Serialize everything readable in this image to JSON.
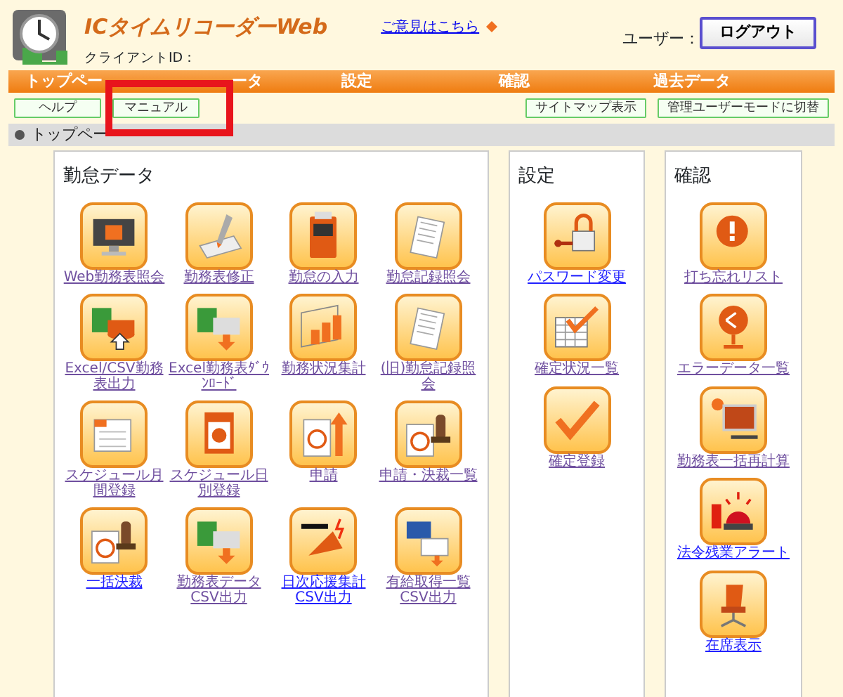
{
  "header": {
    "title": "ICタイムリコーダーWeb",
    "client_id_label": "クライアントID：",
    "feedback_link": "ご意見はこちら",
    "user_label": "ユーザー：",
    "logout_button": "ログアウト"
  },
  "nav_tabs": [
    "トップペー",
    "ータ",
    "設定",
    "確認",
    "過去データ"
  ],
  "sub_buttons_left": [
    "ヘルプ",
    "マニュアル"
  ],
  "sub_buttons_right": [
    "サイトマップ表示",
    "管理ユーザーモードに切替"
  ],
  "breadcrumb": "トップペー",
  "panels": [
    {
      "title": "勤怠データ",
      "items": [
        {
          "label": "Web勤務表照会",
          "visited": true
        },
        {
          "label": "勤務表修正",
          "visited": true
        },
        {
          "label": "勤怠の入力",
          "visited": true
        },
        {
          "label": "勤怠記録照会",
          "visited": true
        },
        {
          "label": "Excel/CSV勤務表出力",
          "visited": true
        },
        {
          "label": "Excel勤務表ﾀﾞｳﾝﾛｰﾄﾞ",
          "visited": true
        },
        {
          "label": "勤務状況集計",
          "visited": true
        },
        {
          "label": "(旧)勤怠記録照会",
          "visited": true
        },
        {
          "label": "スケジュール月間登録",
          "visited": true
        },
        {
          "label": "スケジュール日別登録",
          "visited": true
        },
        {
          "label": "申請",
          "visited": true
        },
        {
          "label": "申請・決裁一覧",
          "visited": true
        },
        {
          "label": "一括決裁",
          "visited": false
        },
        {
          "label": "勤務表データCSV出力",
          "visited": true
        },
        {
          "label": "日次応援集計CSV出力",
          "visited": false
        },
        {
          "label": "有給取得一覧CSV出力",
          "visited": true
        }
      ]
    },
    {
      "title": "設定",
      "items": [
        {
          "label": "パスワード変更",
          "visited": false
        },
        {
          "label": "確定状況一覧",
          "visited": true
        },
        {
          "label": "確定登録",
          "visited": true
        }
      ]
    },
    {
      "title": "確認",
      "items": [
        {
          "label": "打ち忘れリスト",
          "visited": true
        },
        {
          "label": "エラーデータ一覧",
          "visited": true
        },
        {
          "label": "勤務表一括再計算",
          "visited": true
        },
        {
          "label": "法令残業アラート",
          "visited": false
        },
        {
          "label": "在席表示",
          "visited": false
        }
      ]
    }
  ]
}
